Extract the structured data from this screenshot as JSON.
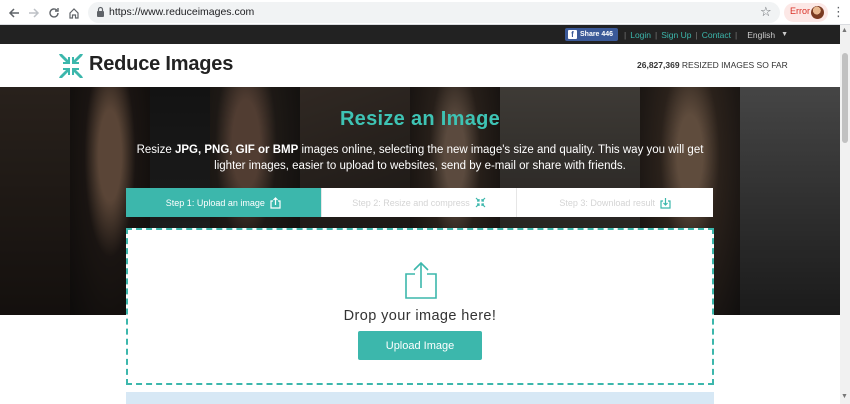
{
  "browser": {
    "url": "https://www.reduceimages.com",
    "error_label": "Error",
    "icons": [
      "back-icon",
      "forward-icon",
      "reload-icon",
      "home-icon",
      "lock-icon",
      "star-icon",
      "menu-icon"
    ]
  },
  "topbar": {
    "share_label": "Share 446",
    "links": [
      "Login",
      "Sign Up",
      "Contact"
    ],
    "language": "English"
  },
  "header": {
    "logo_text": "Reduce Images",
    "counter_number": "26,827,369",
    "counter_suffix": "RESIZED IMAGES SO FAR"
  },
  "hero": {
    "title": "Resize an Image",
    "desc_prefix": "Resize",
    "desc_formats": "JPG, PNG, GIF or BMP",
    "desc_rest": "images online, selecting the new image's size and quality. This way you will get lighter images, easier to upload to websites, send by e-mail or share with friends."
  },
  "steps": [
    {
      "label": "Step 1: Upload an image",
      "active": true,
      "icon": "upload-icon"
    },
    {
      "label": "Step 2: Resize and compress",
      "active": false,
      "icon": "compress-icon"
    },
    {
      "label": "Step 3: Download result",
      "active": false,
      "icon": "download-icon"
    }
  ],
  "dropzone": {
    "text": "Drop your image here!",
    "button_label": "Upload Image"
  },
  "colors": {
    "accent": "#3cb7ac",
    "topbar_bg": "#222222",
    "facebook": "#3b5998"
  }
}
